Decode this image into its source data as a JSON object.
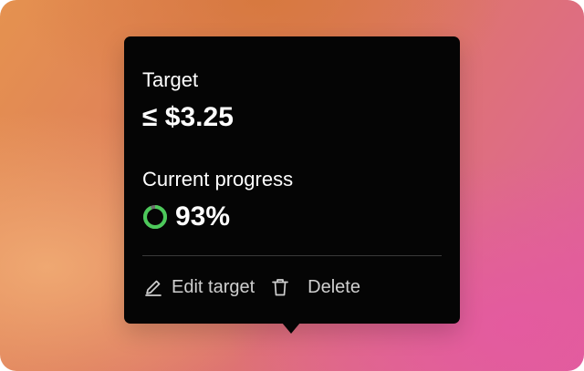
{
  "popover": {
    "target_label": "Target",
    "target_value": "≤ $3.25",
    "progress_label": "Current progress",
    "progress_value": "93%",
    "progress_fraction": 0.93,
    "progress_icon": "progress-ring-icon",
    "actions": [
      {
        "label": "Edit target",
        "icon": "pencil-icon"
      },
      {
        "label": "Delete",
        "icon": "trash-icon"
      }
    ]
  },
  "colors": {
    "popover_bg": "#050505",
    "progress_green": "#4cc95a",
    "progress_track": "#6e6e6e",
    "action_text": "#cfcfcf",
    "divider": "#3a3a3a"
  }
}
